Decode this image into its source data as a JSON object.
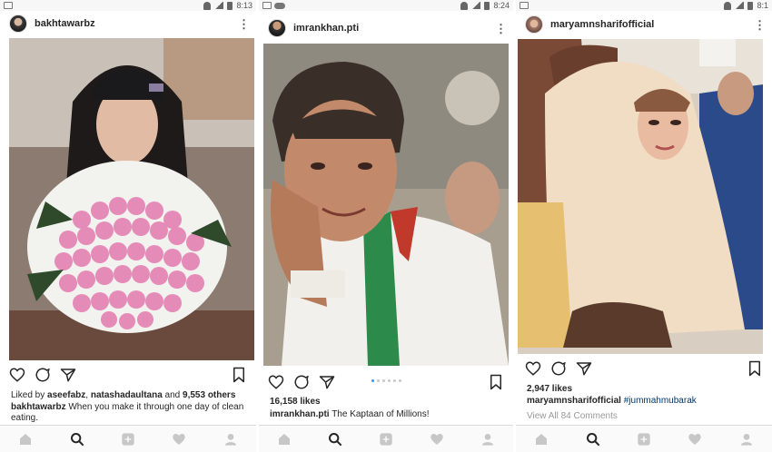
{
  "status": {
    "p1_time": "8:13",
    "p2_time": "8:24",
    "p3_time": "8:1"
  },
  "posts": [
    {
      "username": "bakhtawarbz",
      "likers_prefix": "Liked by ",
      "liker1": "aseefabz",
      "sep": ", ",
      "liker2": "natashadaultana",
      "and": " and ",
      "others": "9,553 others",
      "caption_user": "bakhtawarbz",
      "caption": "When you make it through one day of clean eating."
    },
    {
      "username": "imrankhan.pti",
      "likes": "16,158 likes",
      "caption_user": "imrankhan.pti",
      "caption": "The Kaptaan of Millions!"
    },
    {
      "username": "maryamnsharifofficial",
      "likes": "2,947 likes",
      "caption_user": "maryamnsharifofficial",
      "hashtag": "#jummahmubarak",
      "comments": "View All 84 Comments"
    }
  ],
  "icons": [
    "heart-icon",
    "comment-icon",
    "share-icon",
    "bookmark-icon",
    "home-icon",
    "search-icon",
    "add-icon",
    "activity-icon",
    "profile-icon",
    "more-icon"
  ],
  "colors": {
    "link": "#003569",
    "active_dot": "#3897f0",
    "muted": "#999999"
  }
}
